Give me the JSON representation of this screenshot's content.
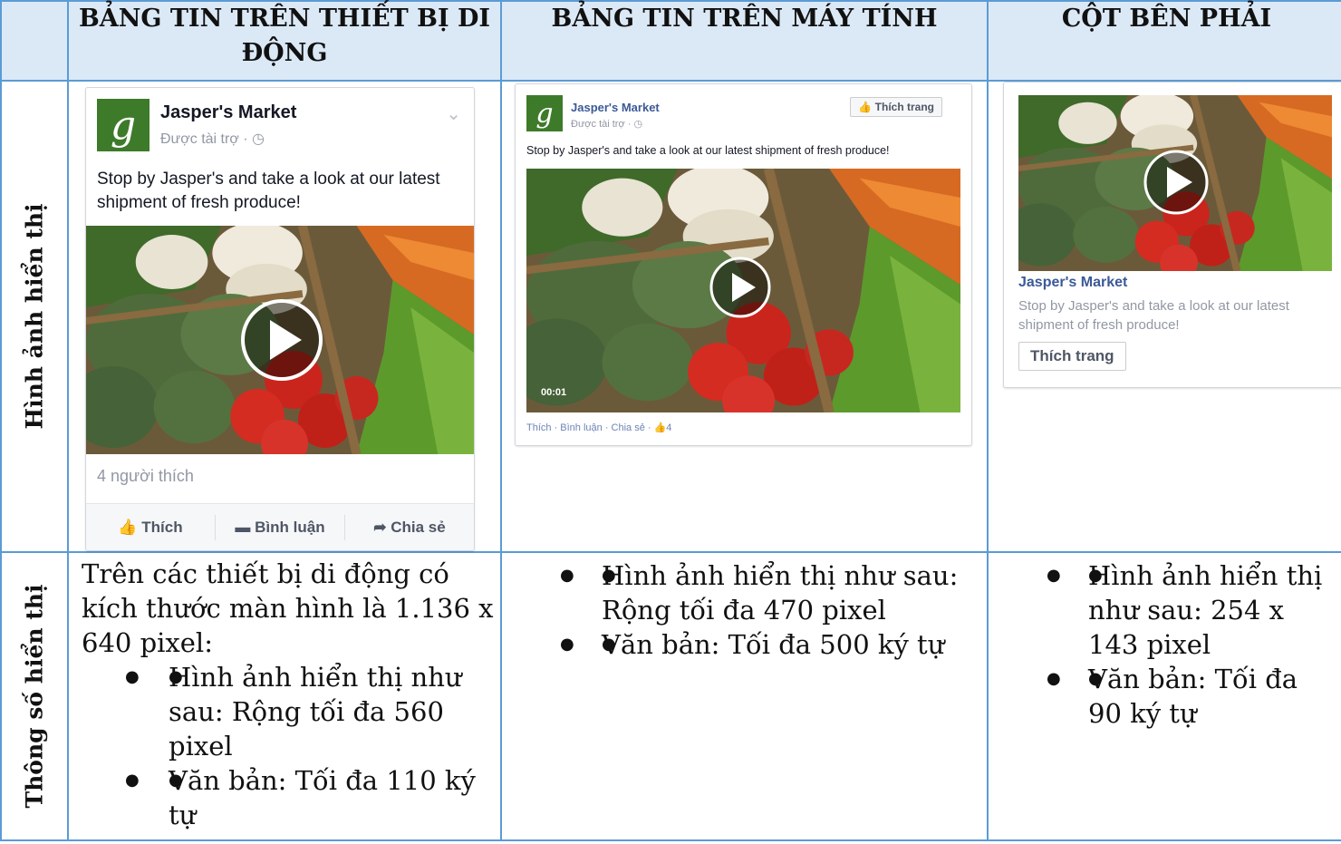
{
  "headers": {
    "col1": "BẢNG TIN TRÊN THIẾT BỊ DI ĐỘNG",
    "col2": "BẢNG TIN TRÊN MÁY TÍNH",
    "col3": "CỘT BÊN PHẢI"
  },
  "row_labels": {
    "image": "Hình ảnh hiển thị",
    "specs": "Thông số hiển thị"
  },
  "mobile_ad": {
    "logo_letter": "g",
    "page_name": "Jasper's Market",
    "sponsored": "Được tài trợ · ◷",
    "chevron": "⌄",
    "post_text": "Stop by Jasper's and take a look at our latest shipment of fresh produce!",
    "likes": "4 người thích",
    "actions": [
      "Thích",
      "Bình luận",
      "Chia sẻ"
    ]
  },
  "desktop_ad": {
    "logo_letter": "g",
    "page_name": "Jasper's Market",
    "sponsored": "Được tài trợ · ◷",
    "like_button": "Thích trang",
    "post_text": "Stop by Jasper's and take a look at our latest shipment of fresh produce!",
    "video_time": "00:01",
    "footer": "Thích · Bình luận · Chia sẻ · 👍4"
  },
  "right_ad": {
    "page_name": "Jasper's Market",
    "post_text": "Stop by Jasper's and take a look at our latest shipment of fresh produce!",
    "like_button": "Thích trang"
  },
  "specs": {
    "mobile_intro": "Trên các thiết bị di động có kích thước màn hình là 1.136 x 640 pixel:",
    "mobile_items": [
      "Hình ảnh hiển thị như sau: Rộng tối đa 560 pixel",
      "Văn bản: Tối đa 110 ký tự"
    ],
    "desktop_items": [
      "Hình ảnh hiển thị như sau: Rộng tối đa 470 pixel",
      "Văn bản: Tối đa 500 ký tự"
    ],
    "right_items": [
      "Hình ảnh hiển thị như sau: 254 x 143 pixel",
      "Văn bản: Tối đa 90 ký tự"
    ]
  },
  "colors": {
    "border": "#5b9bd5",
    "header_bg": "#dbe9f6",
    "brand_green": "#3d7b2a",
    "fb_blue": "#3b5998"
  }
}
